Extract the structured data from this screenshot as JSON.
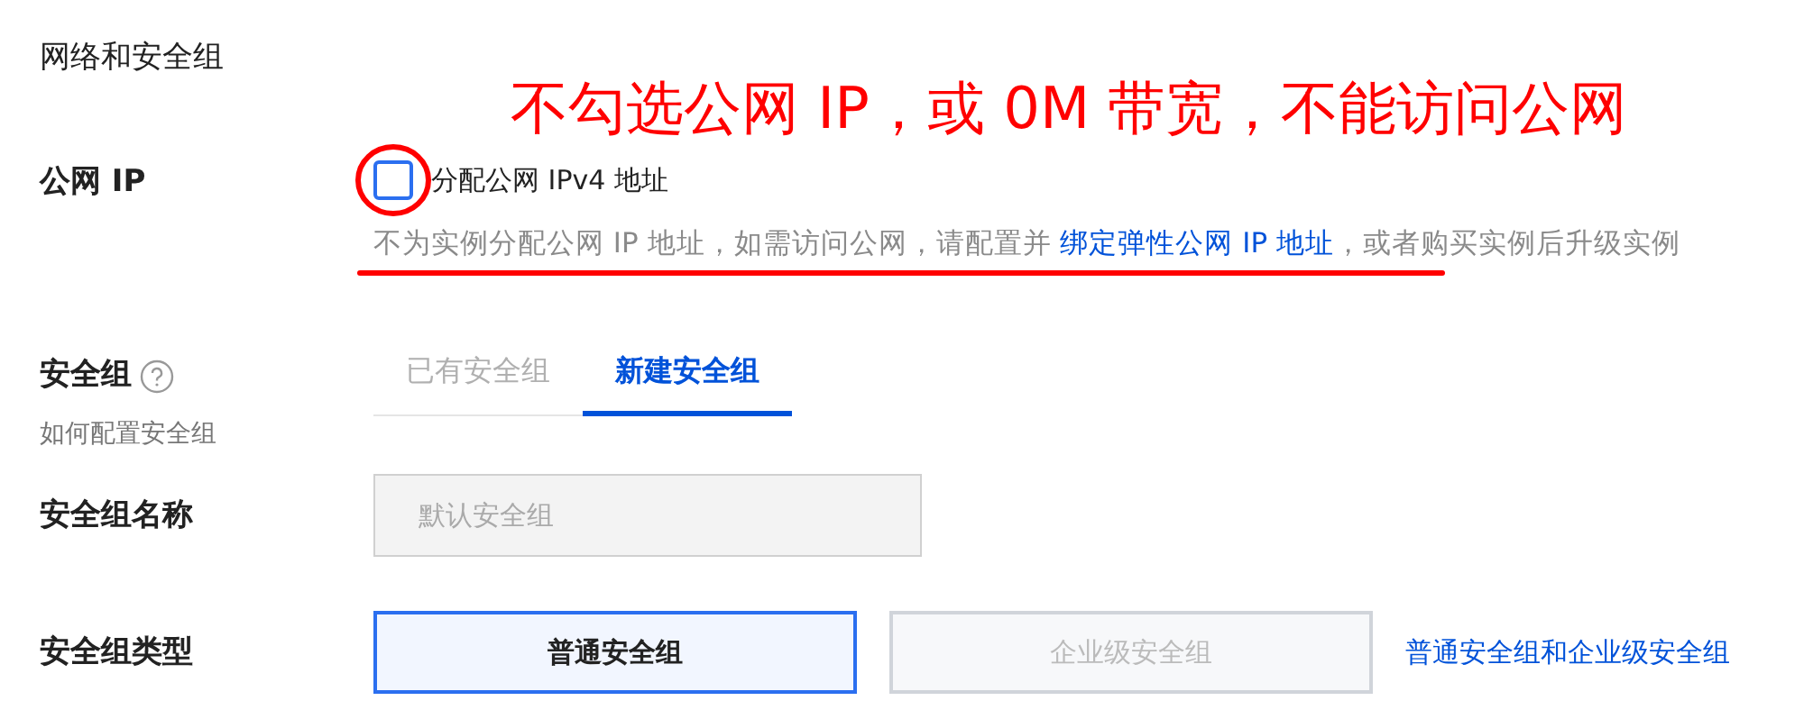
{
  "section_title": "网络和安全组",
  "annotation": "不勾选公网 IP，或 0M 带宽，不能访问公网",
  "public_ip": {
    "label": "公网 IP",
    "checkbox": {
      "label": "分配公网 IPv4 地址",
      "checked": false
    },
    "hint": {
      "before": "不为实例分配公网 IP 地址，如需访问公网，请配置并 ",
      "link": "绑定弹性公网 IP 地址",
      "after": "，或者购买实例后升级实例"
    }
  },
  "security_group": {
    "label": "安全组",
    "help_link": "如何配置安全组",
    "tabs": [
      {
        "label": "已有安全组",
        "selected": false
      },
      {
        "label": "新建安全组",
        "selected": true
      }
    ]
  },
  "name_field": {
    "label": "安全组名称",
    "placeholder": "默认安全组"
  },
  "type": {
    "label": "安全组类型",
    "options": [
      {
        "label": "普通安全组",
        "selected": true
      },
      {
        "label": "企业级安全组",
        "selected": false
      }
    ],
    "link": "普通安全组和企业级安全组"
  }
}
